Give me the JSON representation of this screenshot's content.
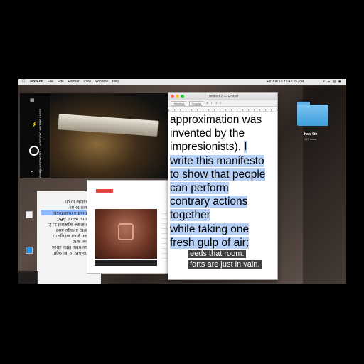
{
  "menubar": {
    "app_name": "TextEdit",
    "items": [
      "File",
      "Edit",
      "Format",
      "View",
      "Window",
      "Help"
    ],
    "clock": "Fri Jun 15  11:42:25 PM"
  },
  "textedit": {
    "title": "Untitled 2 — Edited",
    "font_family": "Helvetica",
    "font_style": "Regular",
    "lines": [
      {
        "text": "approximation was",
        "selected": false
      },
      {
        "text": "invented by the",
        "selected": false
      },
      {
        "text": "impresionists). ",
        "selected": false,
        "sel_tail": "I"
      },
      {
        "text": "write this manifesto",
        "selected": true
      },
      {
        "text": "to show that people",
        "selected": true
      },
      {
        "text": "can perform",
        "selected": true
      },
      {
        "text": "contrary actions",
        "selected": true
      },
      {
        "text": "together",
        "selected": true
      },
      {
        "text": "while taking one",
        "selected": true
      },
      {
        "text": "fresh gulp of air;",
        "selected": true
      }
    ]
  },
  "subtitles": [
    "eeds that room.",
    "forts are just in vain."
  ],
  "flipnotes": {
    "lines": [
      "and the ABCs. In sight",
      "disassemble little abcs",
      "conquer and",
      "sharpen your wings to",
      "to fly into a rage and",
      "to fulminate against 1, 2,",
      "you must want: ABC",
      "To put out a manifesto",
      "proclaim to us",
      "impossible to ch"
    ]
  },
  "folder": {
    "name": "haw 6th",
    "count": "157 items"
  },
  "camera": {
    "modes": [
      "TIME-LAPSE",
      "SLO-MO",
      "VIDEO",
      "PHOTO",
      "SQUARE",
      "PANO"
    ]
  }
}
